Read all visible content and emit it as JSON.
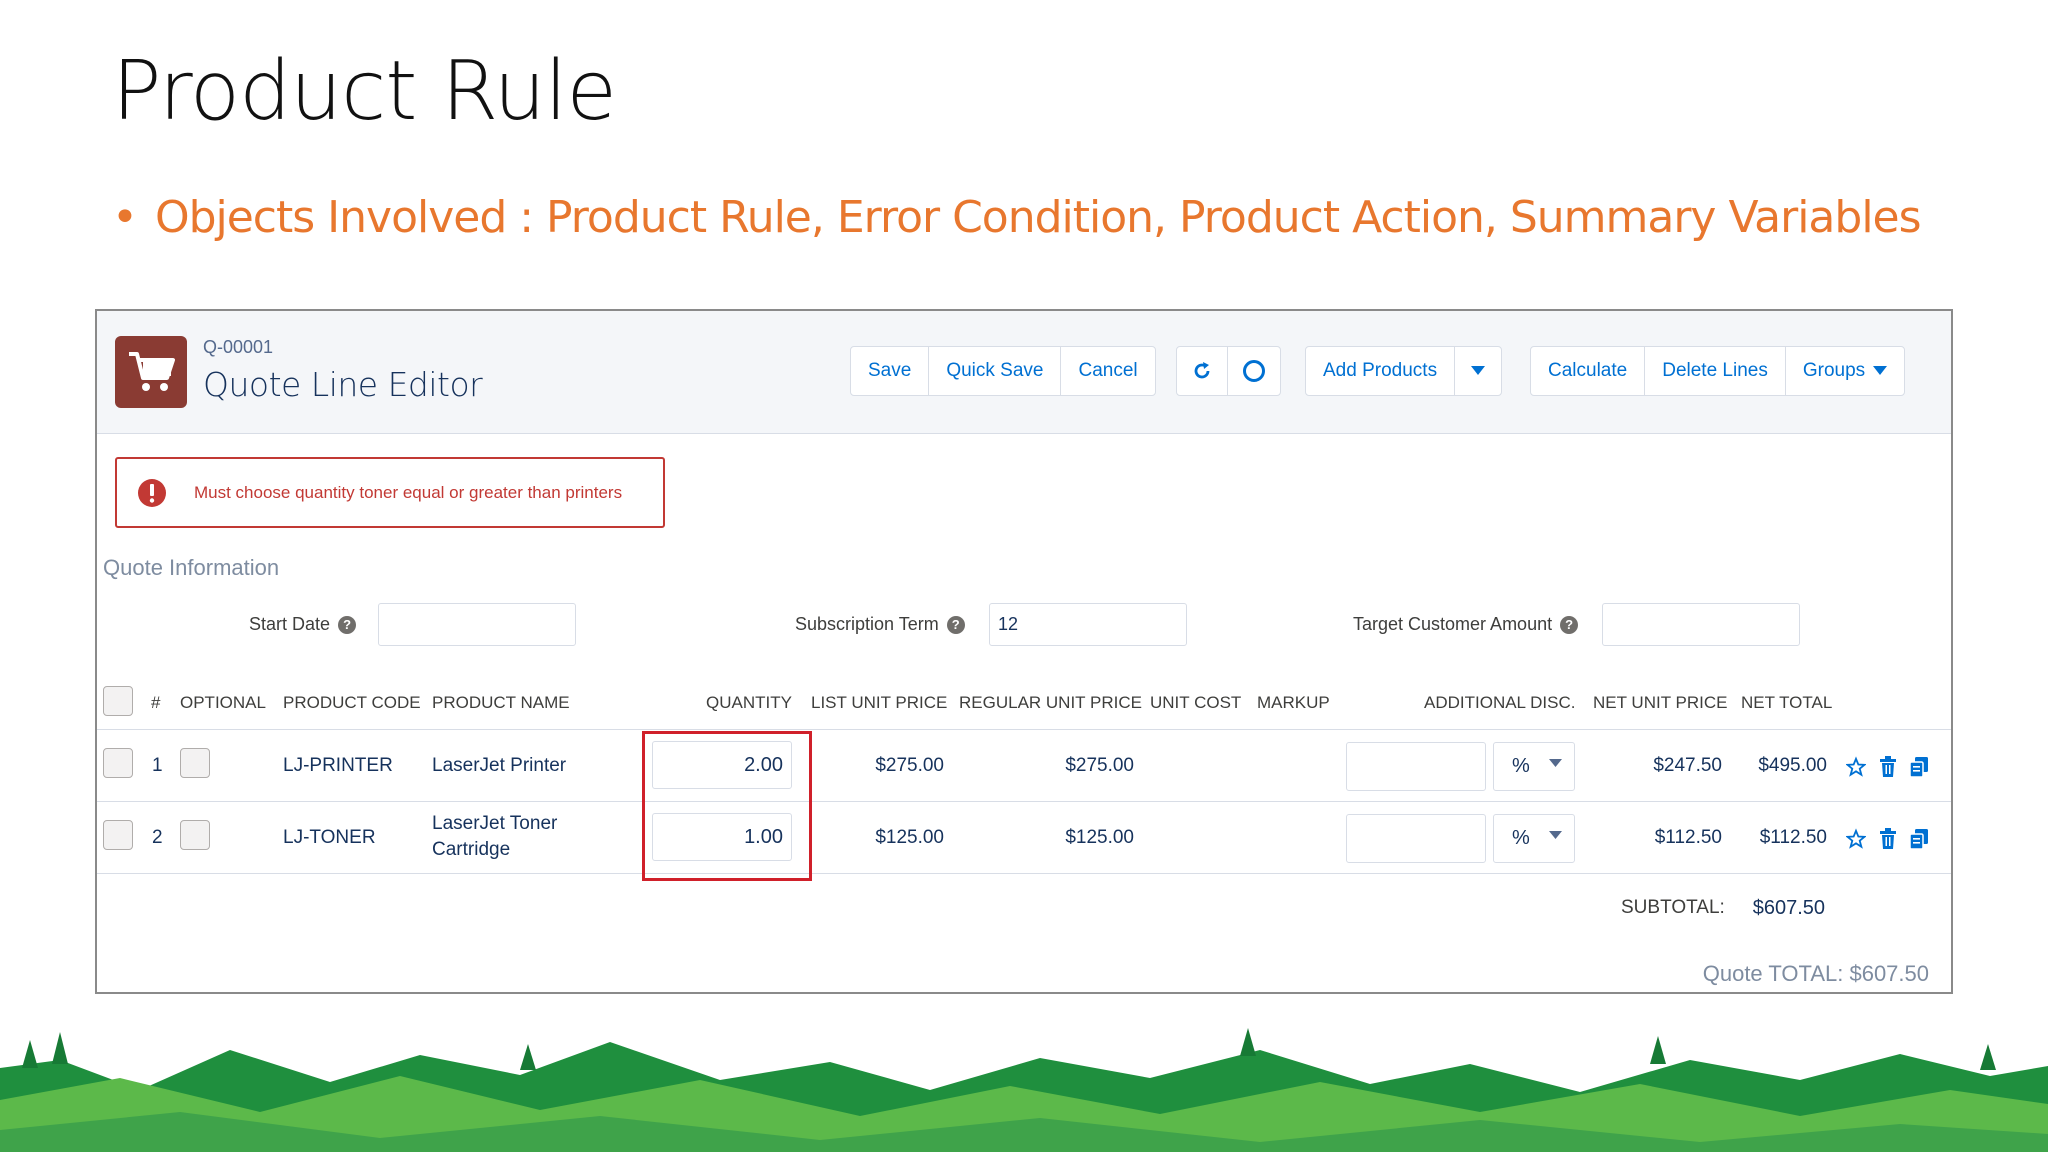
{
  "slide": {
    "title": "Product Rule",
    "bullet": "Objects Involved : Product Rule, Error Condition, Product Action, Summary Variables",
    "bullet_color": "#e8772e"
  },
  "header": {
    "quote_number": "Q-00001",
    "title": "Quote Line Editor",
    "buttons": {
      "save": "Save",
      "quick_save": "Quick Save",
      "cancel": "Cancel",
      "add_products": "Add Products",
      "calculate": "Calculate",
      "delete_lines": "Delete Lines",
      "groups": "Groups"
    },
    "icon_color": "#8a3b33"
  },
  "error": {
    "message": "Must choose quantity toner equal or greater than printers"
  },
  "quote_info": {
    "section_label": "Quote Information",
    "start_date_label": "Start Date",
    "start_date_value": "",
    "subscription_term_label": "Subscription Term",
    "subscription_term_value": "12",
    "target_amount_label": "Target Customer Amount",
    "target_amount_value": ""
  },
  "table": {
    "columns": {
      "num": "#",
      "optional": "OPTIONAL",
      "product_code": "PRODUCT CODE",
      "product_name": "PRODUCT NAME",
      "quantity": "QUANTITY",
      "list_unit_price": "LIST UNIT PRICE",
      "regular_unit_price": "REGULAR UNIT PRICE",
      "unit_cost": "UNIT COST",
      "markup": "MARKUP",
      "additional_disc": "ADDITIONAL DISC.",
      "net_unit_price": "NET UNIT PRICE",
      "net_total": "NET TOTAL"
    },
    "rows": [
      {
        "num": "1",
        "product_code": "LJ-PRINTER",
        "product_name_line1": "LaserJet Printer",
        "product_name_line2": "",
        "quantity": "2.00",
        "list_unit_price": "$275.00",
        "regular_unit_price": "$275.00",
        "disc_type": "%",
        "net_unit_price": "$247.50",
        "net_total": "$495.00"
      },
      {
        "num": "2",
        "product_code": "LJ-TONER",
        "product_name_line1": "LaserJet Toner",
        "product_name_line2": "Cartridge",
        "quantity": "1.00",
        "list_unit_price": "$125.00",
        "regular_unit_price": "$125.00",
        "disc_type": "%",
        "net_unit_price": "$112.50",
        "net_total": "$112.50"
      }
    ],
    "subtotal_label": "SUBTOTAL:",
    "subtotal_value": "$607.50"
  },
  "footer": {
    "quote_total": "Quote TOTAL: $607.50"
  },
  "colors": {
    "link_blue": "#0070d2",
    "error_red": "#c23934",
    "highlight_red": "#d0202a",
    "hill_green_dark": "#1f8f3e",
    "hill_green_light": "#5cb94a"
  }
}
